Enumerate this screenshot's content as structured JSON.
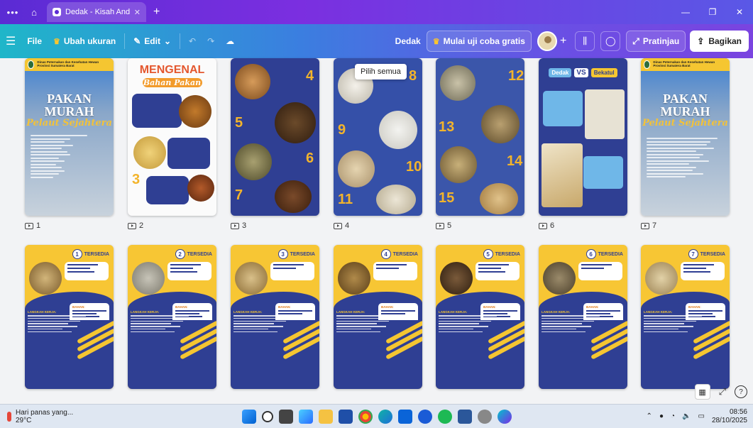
{
  "browser": {
    "tab_title": "Dedak - Kisah Anda...",
    "menu_icon": "ellipsis-icon",
    "home_icon": "home-icon"
  },
  "toolbar": {
    "file": "File",
    "resize": "Ubah ukuran",
    "edit": "Edit",
    "doc_title": "Dedak",
    "trial": "Mulai uji coba gratis",
    "preview": "Pratinjau",
    "share": "Bagikan"
  },
  "tooltip": "Pilih semua",
  "slides_row1": [
    {
      "page": "1",
      "title": "PAKAN MURAH",
      "subtitle": "Pelaut Sejahtera",
      "header": "Dinas Peternakan dan Kesehatan Hewan Provinsi Sumatera Barat"
    },
    {
      "page": "2",
      "title": "MENGENAL",
      "subtitle": "Bahan Pakan"
    },
    {
      "page": "3"
    },
    {
      "page": "4"
    },
    {
      "page": "5"
    },
    {
      "page": "6",
      "left": "Dedak",
      "vs": "VS",
      "right": "Bekatul"
    },
    {
      "page": "7",
      "title": "PAKAN MURAH",
      "subtitle": "Pelaut Sejahtera",
      "header": "Dinas Peternakan dan Kesehatan Hewan Provinsi Sumatera Barat"
    }
  ],
  "slides_row2": [
    {
      "num": "1",
      "label": "TERSEDIA"
    },
    {
      "num": "2",
      "label": "TERSEDIA"
    },
    {
      "num": "3",
      "label": "TERSEDIA"
    },
    {
      "num": "4",
      "label": "TERSEDIA"
    },
    {
      "num": "5",
      "label": "TERSEDIA"
    },
    {
      "num": "6",
      "label": "TERSEDIA"
    },
    {
      "num": "7",
      "label": "TERSEDIA"
    }
  ],
  "slide_texts": {
    "bahan": "BAHAN:",
    "langkah": "LANGKAH KERJA:"
  },
  "taskbar": {
    "weather_text": "Hari panas yang...",
    "temp": "29°C",
    "time": "08:56",
    "date": "28/10/2025"
  },
  "colors": {
    "navy": "#2f3f93",
    "yellow": "#f5c631",
    "purple": "#7b2fe0",
    "teal": "#1fb6c9"
  }
}
